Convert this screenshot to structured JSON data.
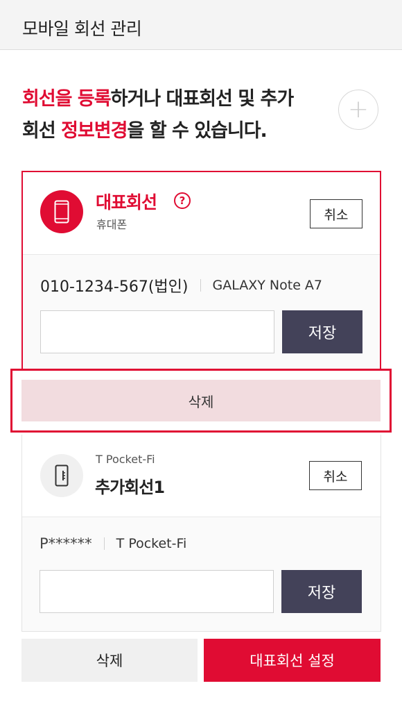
{
  "header": {
    "title": "모바일 회선 관리"
  },
  "intro": {
    "part1": "회선을 등록",
    "part2": "하거나 대표회선 및 추가",
    "part3": "회선 ",
    "part4": "정보변경",
    "part5": "을 할 수 있습니다."
  },
  "add_button": {
    "symbol": "+"
  },
  "primary_line": {
    "label": "대표회선",
    "help_symbol": "?",
    "sub_label": "휴대폰",
    "cancel_label": "취소",
    "number": "010-1234-567(법인)",
    "model": "GALAXY Note A7",
    "input_value": "",
    "save_label": "저장",
    "delete_label": "삭제"
  },
  "additional_line": {
    "type": "T Pocket-Fi",
    "label": "추가회선1",
    "cancel_label": "취소",
    "number": "P******",
    "model": "T Pocket-Fi",
    "input_value": "",
    "save_label": "저장"
  },
  "footer": {
    "delete_label": "삭제",
    "set_primary_label": "대표회선 설정"
  },
  "colors": {
    "accent": "#e00c33",
    "save_button": "#434259",
    "highlight_fill": "#f2dcdf"
  }
}
